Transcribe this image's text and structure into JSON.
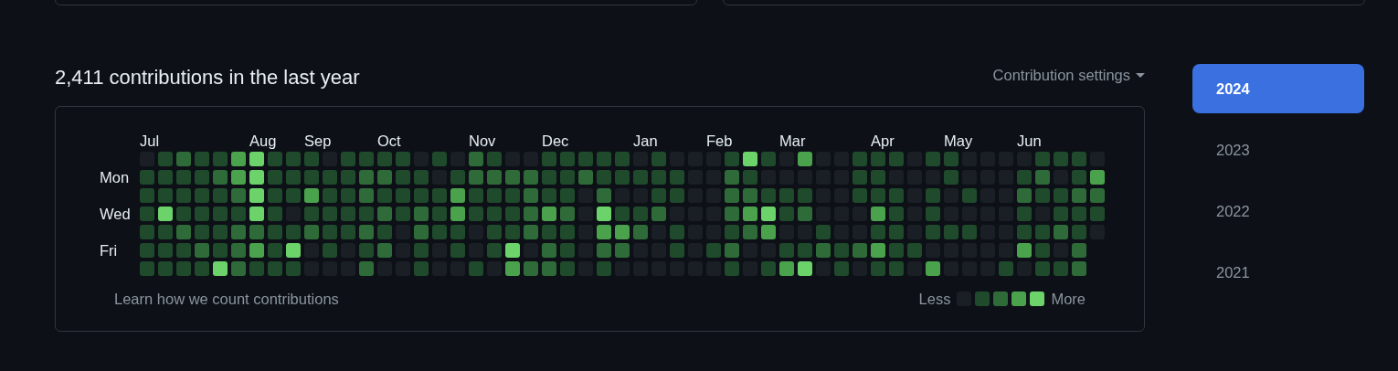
{
  "heading": "2,411 contributions in the last year",
  "settings_menu": {
    "label": "Contribution settings"
  },
  "day_labels": [
    {
      "label": "Mon"
    },
    {
      "label": "Wed"
    },
    {
      "label": "Fri"
    }
  ],
  "weeks": [
    {
      "month": "Jul",
      "days": [
        {
          "color": "#1a1e25"
        },
        {
          "color": "#1f4a2b"
        },
        {
          "color": "#1f4a2b"
        },
        {
          "color": "#1f4a2b"
        },
        {
          "color": "#1f4a2b"
        },
        {
          "color": "#1f4a2b"
        },
        {
          "color": "#1f4a2b"
        }
      ]
    },
    {
      "days": [
        {
          "color": "#1f4a2b"
        },
        {
          "color": "#1f4a2b"
        },
        {
          "color": "#1f4a2b"
        },
        {
          "color": "#6bd36a"
        },
        {
          "color": "#1f4a2b"
        },
        {
          "color": "#1f4a2b"
        },
        {
          "color": "#1f4a2b"
        }
      ]
    },
    {
      "days": [
        {
          "color": "#2e6b38"
        },
        {
          "color": "#1f4a2b"
        },
        {
          "color": "#1f4a2b"
        },
        {
          "color": "#1f4a2b"
        },
        {
          "color": "#2e6b38"
        },
        {
          "color": "#1f4a2b"
        },
        {
          "color": "#1f4a2b"
        }
      ]
    },
    {
      "days": [
        {
          "color": "#1f4a2b"
        },
        {
          "color": "#1f4a2b"
        },
        {
          "color": "#1f4a2b"
        },
        {
          "color": "#1f4a2b"
        },
        {
          "color": "#1f4a2b"
        },
        {
          "color": "#2e6b38"
        },
        {
          "color": "#1f4a2b"
        }
      ]
    },
    {
      "days": [
        {
          "color": "#1f4a2b"
        },
        {
          "color": "#2e6b38"
        },
        {
          "color": "#1f4a2b"
        },
        {
          "color": "#1f4a2b"
        },
        {
          "color": "#1f4a2b"
        },
        {
          "color": "#1f4a2b"
        },
        {
          "color": "#6bd36a"
        }
      ]
    },
    {
      "days": [
        {
          "color": "#4aa34c"
        },
        {
          "color": "#4aa34c"
        },
        {
          "color": "#2e6b38"
        },
        {
          "color": "#1f4a2b"
        },
        {
          "color": "#2e6b38"
        },
        {
          "color": "#2e6b38"
        },
        {
          "color": "#2e6b38"
        }
      ]
    },
    {
      "month": "Aug",
      "days": [
        {
          "color": "#6bd36a"
        },
        {
          "color": "#6bd36a"
        },
        {
          "color": "#6bd36a"
        },
        {
          "color": "#6bd36a"
        },
        {
          "color": "#2e6b38"
        },
        {
          "color": "#4aa34c"
        },
        {
          "color": "#1f4a2b"
        }
      ]
    },
    {
      "days": [
        {
          "color": "#1f4a2b"
        },
        {
          "color": "#1f4a2b"
        },
        {
          "color": "#1f4a2b"
        },
        {
          "color": "#1f4a2b"
        },
        {
          "color": "#1f4a2b"
        },
        {
          "color": "#1f4a2b"
        },
        {
          "color": "#1f4a2b"
        }
      ]
    },
    {
      "days": [
        {
          "color": "#1f4a2b"
        },
        {
          "color": "#1f4a2b"
        },
        {
          "color": "#1f4a2b"
        },
        {
          "color": "#1a1e25"
        },
        {
          "color": "#1f4a2b"
        },
        {
          "color": "#6bd36a"
        },
        {
          "color": "#1f4a2b"
        }
      ]
    },
    {
      "month": "Sep",
      "days": [
        {
          "color": "#1f4a2b"
        },
        {
          "color": "#1f4a2b"
        },
        {
          "color": "#4aa34c"
        },
        {
          "color": "#1f4a2b"
        },
        {
          "color": "#2e6b38"
        },
        {
          "color": "#1a1e25"
        },
        {
          "color": "#1a1e25"
        }
      ]
    },
    {
      "days": [
        {
          "color": "#1a1e25"
        },
        {
          "color": "#1f4a2b"
        },
        {
          "color": "#1f4a2b"
        },
        {
          "color": "#1f4a2b"
        },
        {
          "color": "#1f4a2b"
        },
        {
          "color": "#1f4a2b"
        },
        {
          "color": "#1a1e25"
        }
      ]
    },
    {
      "days": [
        {
          "color": "#1f4a2b"
        },
        {
          "color": "#1f4a2b"
        },
        {
          "color": "#1f4a2b"
        },
        {
          "color": "#1f4a2b"
        },
        {
          "color": "#1f4a2b"
        },
        {
          "color": "#1a1e25"
        },
        {
          "color": "#1a1e25"
        }
      ]
    },
    {
      "days": [
        {
          "color": "#1f4a2b"
        },
        {
          "color": "#2e6b38"
        },
        {
          "color": "#2e6b38"
        },
        {
          "color": "#1f4a2b"
        },
        {
          "color": "#2e6b38"
        },
        {
          "color": "#1f4a2b"
        },
        {
          "color": "#2e6b38"
        }
      ]
    },
    {
      "month": "Oct",
      "days": [
        {
          "color": "#1f4a2b"
        },
        {
          "color": "#2e6b38"
        },
        {
          "color": "#1f4a2b"
        },
        {
          "color": "#2e6b38"
        },
        {
          "color": "#1f4a2b"
        },
        {
          "color": "#2e6b38"
        },
        {
          "color": "#1a1e25"
        }
      ]
    },
    {
      "days": [
        {
          "color": "#1f4a2b"
        },
        {
          "color": "#1f4a2b"
        },
        {
          "color": "#1f4a2b"
        },
        {
          "color": "#1f4a2b"
        },
        {
          "color": "#1a1e25"
        },
        {
          "color": "#1a1e25"
        },
        {
          "color": "#1a1e25"
        }
      ]
    },
    {
      "days": [
        {
          "color": "#1a1e25"
        },
        {
          "color": "#1f4a2b"
        },
        {
          "color": "#1f4a2b"
        },
        {
          "color": "#2e6b38"
        },
        {
          "color": "#2e6b38"
        },
        {
          "color": "#1f4a2b"
        },
        {
          "color": "#1f4a2b"
        }
      ]
    },
    {
      "days": [
        {
          "color": "#1f4a2b"
        },
        {
          "color": "#1a1e25"
        },
        {
          "color": "#1f4a2b"
        },
        {
          "color": "#1f4a2b"
        },
        {
          "color": "#1f4a2b"
        },
        {
          "color": "#1a1e25"
        },
        {
          "color": "#1a1e25"
        }
      ]
    },
    {
      "days": [
        {
          "color": "#1a1e25"
        },
        {
          "color": "#1f4a2b"
        },
        {
          "color": "#4aa34c"
        },
        {
          "color": "#4aa34c"
        },
        {
          "color": "#1f4a2b"
        },
        {
          "color": "#1f4a2b"
        },
        {
          "color": "#1a1e25"
        }
      ]
    },
    {
      "month": "Nov",
      "days": [
        {
          "color": "#2e6b38"
        },
        {
          "color": "#2e6b38"
        },
        {
          "color": "#1f4a2b"
        },
        {
          "color": "#1f4a2b"
        },
        {
          "color": "#1a1e25"
        },
        {
          "color": "#1a1e25"
        },
        {
          "color": "#1f4a2b"
        }
      ]
    },
    {
      "days": [
        {
          "color": "#1f4a2b"
        },
        {
          "color": "#2e6b38"
        },
        {
          "color": "#1f4a2b"
        },
        {
          "color": "#1f4a2b"
        },
        {
          "color": "#1f4a2b"
        },
        {
          "color": "#1f4a2b"
        },
        {
          "color": "#1a1e25"
        }
      ]
    },
    {
      "days": [
        {
          "color": "#1a1e25"
        },
        {
          "color": "#2e6b38"
        },
        {
          "color": "#1f4a2b"
        },
        {
          "color": "#1f4a2b"
        },
        {
          "color": "#1f4a2b"
        },
        {
          "color": "#6bd36a"
        },
        {
          "color": "#4aa34c"
        }
      ]
    },
    {
      "days": [
        {
          "color": "#1a1e25"
        },
        {
          "color": "#2e6b38"
        },
        {
          "color": "#2e6b38"
        },
        {
          "color": "#2e6b38"
        },
        {
          "color": "#2e6b38"
        },
        {
          "color": "#1a1e25"
        },
        {
          "color": "#2e6b38"
        }
      ]
    },
    {
      "month": "Dec",
      "days": [
        {
          "color": "#1f4a2b"
        },
        {
          "color": "#1f4a2b"
        },
        {
          "color": "#1f4a2b"
        },
        {
          "color": "#4aa34c"
        },
        {
          "color": "#1f4a2b"
        },
        {
          "color": "#2e6b38"
        },
        {
          "color": "#2e6b38"
        }
      ]
    },
    {
      "days": [
        {
          "color": "#1f4a2b"
        },
        {
          "color": "#1f4a2b"
        },
        {
          "color": "#1f4a2b"
        },
        {
          "color": "#2e6b38"
        },
        {
          "color": "#1f4a2b"
        },
        {
          "color": "#1f4a2b"
        },
        {
          "color": "#1f4a2b"
        }
      ]
    },
    {
      "days": [
        {
          "color": "#1f4a2b"
        },
        {
          "color": "#2e6b38"
        },
        {
          "color": "#1a1e25"
        },
        {
          "color": "#1a1e25"
        },
        {
          "color": "#1a1e25"
        },
        {
          "color": "#1a1e25"
        },
        {
          "color": "#1a1e25"
        }
      ]
    },
    {
      "days": [
        {
          "color": "#1f4a2b"
        },
        {
          "color": "#1f4a2b"
        },
        {
          "color": "#2e6b38"
        },
        {
          "color": "#6bd36a"
        },
        {
          "color": "#4aa34c"
        },
        {
          "color": "#2e6b38"
        },
        {
          "color": "#1f4a2b"
        }
      ]
    },
    {
      "days": [
        {
          "color": "#1f4a2b"
        },
        {
          "color": "#1f4a2b"
        },
        {
          "color": "#1a1e25"
        },
        {
          "color": "#1f4a2b"
        },
        {
          "color": "#4aa34c"
        },
        {
          "color": "#2e6b38"
        },
        {
          "color": "#1a1e25"
        }
      ]
    },
    {
      "month": "Jan",
      "days": [
        {
          "color": "#1a1e25"
        },
        {
          "color": "#1f4a2b"
        },
        {
          "color": "#1a1e25"
        },
        {
          "color": "#1f4a2b"
        },
        {
          "color": "#2e6b38"
        },
        {
          "color": "#1a1e25"
        },
        {
          "color": "#1a1e25"
        }
      ]
    },
    {
      "days": [
        {
          "color": "#1f4a2b"
        },
        {
          "color": "#1f4a2b"
        },
        {
          "color": "#1f4a2b"
        },
        {
          "color": "#2e6b38"
        },
        {
          "color": "#1a1e25"
        },
        {
          "color": "#1a1e25"
        },
        {
          "color": "#1a1e25"
        }
      ]
    },
    {
      "days": [
        {
          "color": "#1a1e25"
        },
        {
          "color": "#1f4a2b"
        },
        {
          "color": "#1f4a2b"
        },
        {
          "color": "#1a1e25"
        },
        {
          "color": "#1f4a2b"
        },
        {
          "color": "#1f4a2b"
        },
        {
          "color": "#1a1e25"
        }
      ]
    },
    {
      "days": [
        {
          "color": "#1a1e25"
        },
        {
          "color": "#1a1e25"
        },
        {
          "color": "#1a1e25"
        },
        {
          "color": "#1a1e25"
        },
        {
          "color": "#1a1e25"
        },
        {
          "color": "#1a1e25"
        },
        {
          "color": "#1a1e25"
        }
      ]
    },
    {
      "month": "Feb",
      "days": [
        {
          "color": "#1a1e25"
        },
        {
          "color": "#1a1e25"
        },
        {
          "color": "#1a1e25"
        },
        {
          "color": "#1a1e25"
        },
        {
          "color": "#1a1e25"
        },
        {
          "color": "#1f4a2b"
        },
        {
          "color": "#1a1e25"
        }
      ]
    },
    {
      "days": [
        {
          "color": "#1f4a2b"
        },
        {
          "color": "#2e6b38"
        },
        {
          "color": "#2e6b38"
        },
        {
          "color": "#2e6b38"
        },
        {
          "color": "#1f4a2b"
        },
        {
          "color": "#2e6b38"
        },
        {
          "color": "#1f4a2b"
        }
      ]
    },
    {
      "days": [
        {
          "color": "#6bd36a"
        },
        {
          "color": "#1f4a2b"
        },
        {
          "color": "#2e6b38"
        },
        {
          "color": "#4aa34c"
        },
        {
          "color": "#2e6b38"
        },
        {
          "color": "#1a1e25"
        },
        {
          "color": "#1a1e25"
        }
      ]
    },
    {
      "days": [
        {
          "color": "#1f4a2b"
        },
        {
          "color": "#1a1e25"
        },
        {
          "color": "#1f4a2b"
        },
        {
          "color": "#6bd36a"
        },
        {
          "color": "#4aa34c"
        },
        {
          "color": "#1a1e25"
        },
        {
          "color": "#1f4a2b"
        }
      ]
    },
    {
      "month": "Mar",
      "days": [
        {
          "color": "#1a1e25"
        },
        {
          "color": "#1a1e25"
        },
        {
          "color": "#1f4a2b"
        },
        {
          "color": "#1f4a2b"
        },
        {
          "color": "#1a1e25"
        },
        {
          "color": "#1f4a2b"
        },
        {
          "color": "#4aa34c"
        }
      ]
    },
    {
      "days": [
        {
          "color": "#4aa34c"
        },
        {
          "color": "#1a1e25"
        },
        {
          "color": "#1f4a2b"
        },
        {
          "color": "#2e6b38"
        },
        {
          "color": "#1a1e25"
        },
        {
          "color": "#1f4a2b"
        },
        {
          "color": "#6bd36a"
        }
      ]
    },
    {
      "days": [
        {
          "color": "#1a1e25"
        },
        {
          "color": "#1a1e25"
        },
        {
          "color": "#1a1e25"
        },
        {
          "color": "#1a1e25"
        },
        {
          "color": "#1f4a2b"
        },
        {
          "color": "#2e6b38"
        },
        {
          "color": "#1a1e25"
        }
      ]
    },
    {
      "days": [
        {
          "color": "#1a1e25"
        },
        {
          "color": "#1a1e25"
        },
        {
          "color": "#1a1e25"
        },
        {
          "color": "#1a1e25"
        },
        {
          "color": "#1a1e25"
        },
        {
          "color": "#1f4a2b"
        },
        {
          "color": "#1f4a2b"
        }
      ]
    },
    {
      "days": [
        {
          "color": "#1f4a2b"
        },
        {
          "color": "#1f4a2b"
        },
        {
          "color": "#1f4a2b"
        },
        {
          "color": "#1a1e25"
        },
        {
          "color": "#1a1e25"
        },
        {
          "color": "#2e6b38"
        },
        {
          "color": "#1a1e25"
        }
      ]
    },
    {
      "month": "Apr",
      "days": [
        {
          "color": "#1f4a2b"
        },
        {
          "color": "#1f4a2b"
        },
        {
          "color": "#1f4a2b"
        },
        {
          "color": "#4aa34c"
        },
        {
          "color": "#1f4a2b"
        },
        {
          "color": "#4aa34c"
        },
        {
          "color": "#1f4a2b"
        }
      ]
    },
    {
      "days": [
        {
          "color": "#1f4a2b"
        },
        {
          "color": "#1a1e25"
        },
        {
          "color": "#1f4a2b"
        },
        {
          "color": "#1f4a2b"
        },
        {
          "color": "#1f4a2b"
        },
        {
          "color": "#1f4a2b"
        },
        {
          "color": "#1f4a2b"
        }
      ]
    },
    {
      "days": [
        {
          "color": "#1a1e25"
        },
        {
          "color": "#1a1e25"
        },
        {
          "color": "#1a1e25"
        },
        {
          "color": "#1a1e25"
        },
        {
          "color": "#1a1e25"
        },
        {
          "color": "#1f4a2b"
        },
        {
          "color": "#1a1e25"
        }
      ]
    },
    {
      "days": [
        {
          "color": "#1f4a2b"
        },
        {
          "color": "#1a1e25"
        },
        {
          "color": "#1f4a2b"
        },
        {
          "color": "#1f4a2b"
        },
        {
          "color": "#1f4a2b"
        },
        {
          "color": "#1a1e25"
        },
        {
          "color": "#4aa34c"
        }
      ]
    },
    {
      "month": "May",
      "days": [
        {
          "color": "#1f4a2b"
        },
        {
          "color": "#1f4a2b"
        },
        {
          "color": "#1a1e25"
        },
        {
          "color": "#1a1e25"
        },
        {
          "color": "#1f4a2b"
        },
        {
          "color": "#1a1e25"
        },
        {
          "color": "#1a1e25"
        }
      ]
    },
    {
      "days": [
        {
          "color": "#1a1e25"
        },
        {
          "color": "#1a1e25"
        },
        {
          "color": "#1f4a2b"
        },
        {
          "color": "#1a1e25"
        },
        {
          "color": "#1f4a2b"
        },
        {
          "color": "#1a1e25"
        },
        {
          "color": "#1a1e25"
        }
      ]
    },
    {
      "days": [
        {
          "color": "#1a1e25"
        },
        {
          "color": "#1a1e25"
        },
        {
          "color": "#1a1e25"
        },
        {
          "color": "#1a1e25"
        },
        {
          "color": "#1a1e25"
        },
        {
          "color": "#1a1e25"
        },
        {
          "color": "#1a1e25"
        }
      ]
    },
    {
      "days": [
        {
          "color": "#1a1e25"
        },
        {
          "color": "#1a1e25"
        },
        {
          "color": "#1a1e25"
        },
        {
          "color": "#1a1e25"
        },
        {
          "color": "#1a1e25"
        },
        {
          "color": "#1a1e25"
        },
        {
          "color": "#1f4a2b"
        }
      ]
    },
    {
      "month": "Jun",
      "days": [
        {
          "color": "#1a1e25"
        },
        {
          "color": "#1f4a2b"
        },
        {
          "color": "#2e6b38"
        },
        {
          "color": "#1f4a2b"
        },
        {
          "color": "#1f4a2b"
        },
        {
          "color": "#4aa34c"
        },
        {
          "color": "#1a1e25"
        }
      ]
    },
    {
      "days": [
        {
          "color": "#1f4a2b"
        },
        {
          "color": "#2e6b38"
        },
        {
          "color": "#1f4a2b"
        },
        {
          "color": "#1a1e25"
        },
        {
          "color": "#1f4a2b"
        },
        {
          "color": "#1f4a2b"
        },
        {
          "color": "#1f4a2b"
        }
      ]
    },
    {
      "days": [
        {
          "color": "#1f4a2b"
        },
        {
          "color": "#1a1e25"
        },
        {
          "color": "#1f4a2b"
        },
        {
          "color": "#1f4a2b"
        },
        {
          "color": "#2e6b38"
        },
        {
          "color": "#1a1e25"
        },
        {
          "color": "#1f4a2b"
        }
      ]
    },
    {
      "days": [
        {
          "color": "#1f4a2b"
        },
        {
          "color": "#1f4a2b"
        },
        {
          "color": "#2e6b38"
        },
        {
          "color": "#1f4a2b"
        },
        {
          "color": "#1f4a2b"
        },
        {
          "color": "#2e6b38"
        },
        {
          "color": "#2e6b38"
        }
      ]
    },
    {
      "days": [
        {
          "color": "#1a1e25"
        },
        {
          "color": "#4aa34c"
        },
        {
          "color": "#2e6b38"
        },
        {
          "color": "#1f4a2b"
        },
        {
          "color": "#1a1e25"
        }
      ]
    }
  ],
  "footer": {
    "link": "Learn how we count contributions",
    "less": "Less",
    "more": "More"
  },
  "legend": [
    {
      "color": "#1a1e25"
    },
    {
      "color": "#1f4a2b"
    },
    {
      "color": "#2e6b38"
    },
    {
      "color": "#4aa34c"
    },
    {
      "color": "#6bd36a"
    }
  ],
  "years": [
    {
      "label": "2024",
      "selected": true
    },
    {
      "label": "2023",
      "selected": false
    },
    {
      "label": "2022",
      "selected": false
    },
    {
      "label": "2021",
      "selected": false
    }
  ]
}
